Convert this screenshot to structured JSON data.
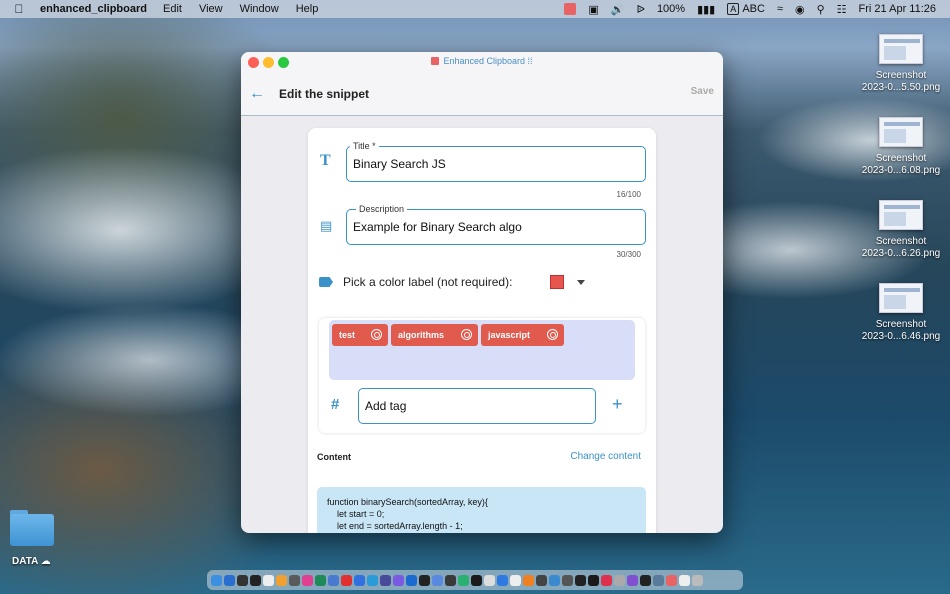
{
  "menubar": {
    "app_name": "enhanced_clipboard",
    "menus": [
      "Edit",
      "View",
      "Window",
      "Help"
    ],
    "battery": "100%",
    "input_source_key": "A",
    "input_source": "ABC",
    "datetime": "Fri 21 Apr  11:26"
  },
  "desktop": {
    "files": [
      {
        "line1": "Screenshot",
        "line2": "2023-0...5.50.png"
      },
      {
        "line1": "Screenshot",
        "line2": "2023-0...6.08.png"
      },
      {
        "line1": "Screenshot",
        "line2": "2023-0...6.26.png"
      },
      {
        "line1": "Screenshot",
        "line2": "2023-0...6.46.png"
      }
    ],
    "folder_label": "DATA"
  },
  "window": {
    "title": "Enhanced Clipboard",
    "page_title": "Edit the snippet",
    "save_label": "Save"
  },
  "form": {
    "title_label": "Title *",
    "title_value": "Binary Search JS",
    "title_counter": "16/100",
    "description_label": "Description",
    "description_value": "Example for Binary Search algo",
    "description_counter": "30/300",
    "color_label": "Pick a color label (not required):",
    "color_value": "#e8554e",
    "tags": [
      "test",
      "algorithms",
      "javascript"
    ],
    "add_tag_placeholder": "Add tag",
    "content_label": "Content",
    "change_content_label": "Change content",
    "code_lines": [
      "function binarySearch(sortedArray, key){",
      "    let start = 0;",
      "    let end = sortedArray.length - 1;"
    ]
  },
  "colors": {
    "accent": "#3a92c8",
    "tag_chip": "#e05a4e",
    "tags_area": "#d9def8",
    "code_bg": "#c9e6f7"
  }
}
